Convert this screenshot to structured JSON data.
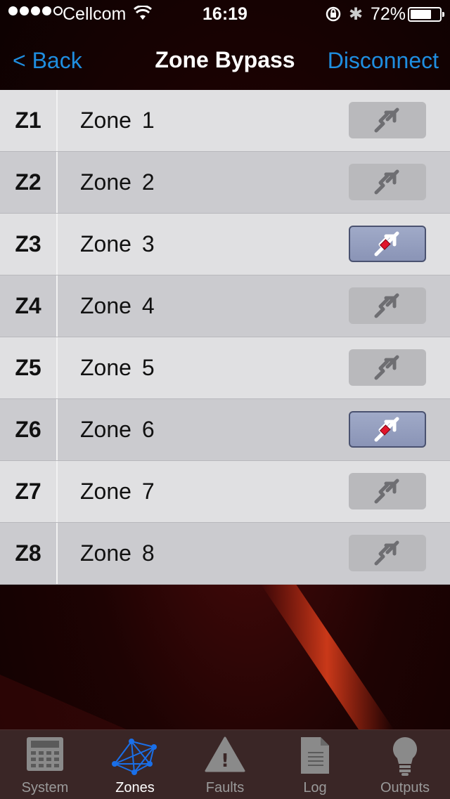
{
  "status_bar": {
    "carrier": "Cellcom",
    "time": "16:19",
    "battery_percent": "72%",
    "battery_level": 0.72,
    "signal_bars_filled": 4,
    "signal_bars_total": 5
  },
  "nav": {
    "back_label": "< Back",
    "title": "Zone Bypass",
    "right_label": "Disconnect"
  },
  "colors": {
    "accent": "#1f8ee0",
    "bypass_active": "#e0142a"
  },
  "zones": [
    {
      "code": "Z1",
      "name": "Zone  1",
      "bypassed": false
    },
    {
      "code": "Z2",
      "name": "Zone  2",
      "bypassed": false
    },
    {
      "code": "Z3",
      "name": "Zone  3",
      "bypassed": true
    },
    {
      "code": "Z4",
      "name": "Zone  4",
      "bypassed": false
    },
    {
      "code": "Z5",
      "name": "Zone  5",
      "bypassed": false
    },
    {
      "code": "Z6",
      "name": "Zone  6",
      "bypassed": true
    },
    {
      "code": "Z7",
      "name": "Zone  7",
      "bypassed": false
    },
    {
      "code": "Z8",
      "name": "Zone  8",
      "bypassed": false
    }
  ],
  "tabs": [
    {
      "label": "System",
      "icon": "calculator-icon",
      "active": false
    },
    {
      "label": "Zones",
      "icon": "network-icon",
      "active": true
    },
    {
      "label": "Faults",
      "icon": "warning-icon",
      "active": false
    },
    {
      "label": "Log",
      "icon": "document-icon",
      "active": false
    },
    {
      "label": "Outputs",
      "icon": "lightbulb-icon",
      "active": false
    }
  ]
}
